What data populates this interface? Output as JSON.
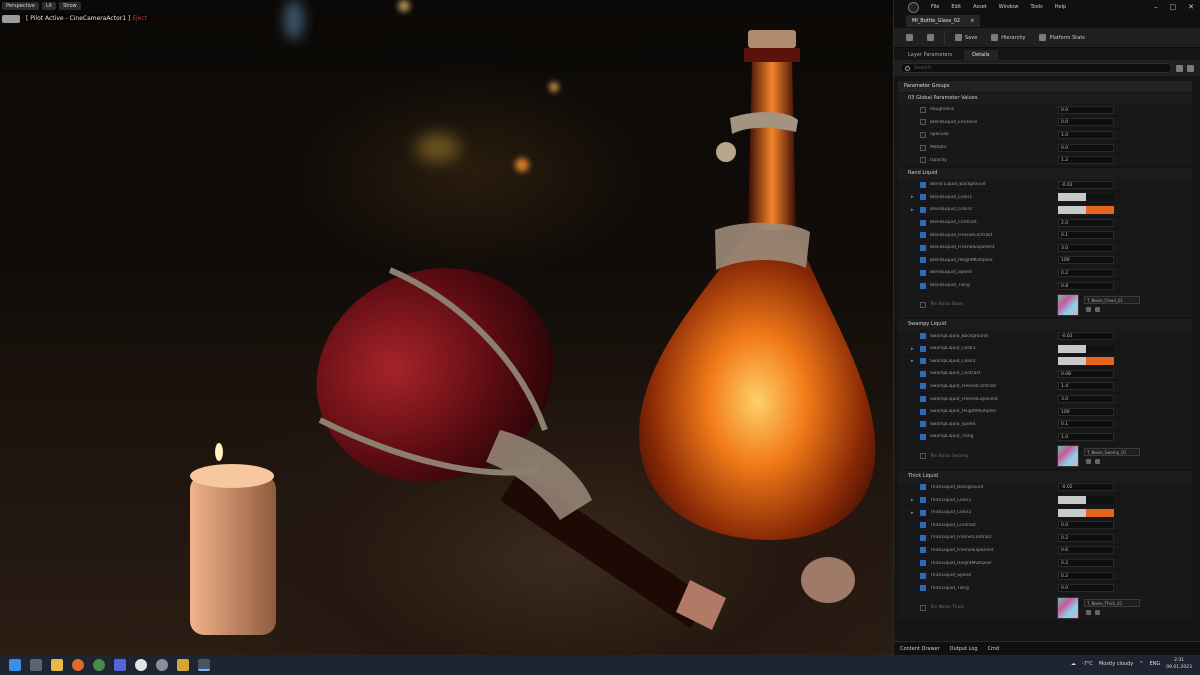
{
  "viewport": {
    "chips": [
      "Perspective",
      "Lit",
      "Show"
    ],
    "pilot_label": "[ Pilot Active - CineCameraActor1 ]",
    "pilot_exit": "Eject"
  },
  "editor": {
    "menu": [
      "File",
      "Edit",
      "Asset",
      "Window",
      "Tools",
      "Help"
    ],
    "tab": "MI_Bottle_Glass_02",
    "toolbar": [
      "Save",
      "Browse",
      "Hierarchy",
      "Platform Stats"
    ],
    "subtabs": [
      "Layer Parameters",
      "Details"
    ],
    "search_placeholder": "Search"
  },
  "props": {
    "category": "Parameter Groups",
    "groups": [
      {
        "title": "03 Global Parameter Values",
        "rows": [
          {
            "label": "Roughness",
            "value": "0.0",
            "on": false
          },
          {
            "label": "BlendLiquid_Emissive",
            "value": "0.0",
            "on": false
          },
          {
            "label": "Specular",
            "value": "1.0",
            "on": false
          },
          {
            "label": "Metallic",
            "value": "0.0",
            "on": false
          },
          {
            "label": "Opacity",
            "value": "1.2",
            "on": false
          }
        ]
      },
      {
        "title": "Rand Liquid",
        "rows": [
          {
            "label": "Blend Liquid_Background",
            "value": "-0.02",
            "on": true
          },
          {
            "label": "BlendLiquid_Color1",
            "swatch": [
              "#c9c9c9",
              "#111111"
            ],
            "on": true,
            "expand": true
          },
          {
            "label": "BlendLiquid_Color2",
            "swatch": [
              "#c9c9c9",
              "#e8661c"
            ],
            "on": true,
            "expand": true
          },
          {
            "label": "BlendLiquid_Contrast",
            "value": "2.0",
            "on": true
          },
          {
            "label": "BlendLiquid_FresnelContrast",
            "value": "0.1",
            "on": true
          },
          {
            "label": "BlendLiquid_FresnelExponent",
            "value": "3.0",
            "on": true
          },
          {
            "label": "BlendLiquid_HeightMultiplier",
            "value": "100",
            "on": true
          },
          {
            "label": "BlendLiquid_Speed",
            "value": "0.2",
            "on": true
          },
          {
            "label": "BlendLiquid_Tiling",
            "value": "0.8",
            "on": true
          }
        ],
        "texture": {
          "label": "Tex Noise Base",
          "dropdown": "T_Noise_Cloud_01"
        }
      },
      {
        "title": "Swampy Liquid",
        "rows": [
          {
            "label": "SwampLiquid_Background",
            "value": "-0.02",
            "on": true
          },
          {
            "label": "SwampLiquid_Color1",
            "swatch": [
              "#c9c9c9",
              "#111111"
            ],
            "on": true,
            "expand": true
          },
          {
            "label": "SwampLiquid_Color2",
            "swatch": [
              "#c9c9c9",
              "#e8661c"
            ],
            "on": true,
            "expand": true
          },
          {
            "label": "SwampLiquid_Contrast",
            "value": "0.08",
            "on": true
          },
          {
            "label": "SwampLiquid_FresnelContrast",
            "value": "1.4",
            "on": true
          },
          {
            "label": "SwampLiquid_FresnelExponent",
            "value": "3.0",
            "on": true
          },
          {
            "label": "SwampLiquid_HeightMultiplier",
            "value": "100",
            "on": true
          },
          {
            "label": "SwampLiquid_Speed",
            "value": "0.1",
            "on": true
          },
          {
            "label": "SwampLiquid_Tiling",
            "value": "1.0",
            "on": true
          }
        ],
        "texture": {
          "label": "Tex Noise Swamp",
          "dropdown": "T_Noise_Swamp_01"
        }
      },
      {
        "title": "Thick Liquid",
        "rows": [
          {
            "label": "ThickLiquid_Background",
            "value": "-0.02",
            "on": true
          },
          {
            "label": "ThickLiquid_Color1",
            "swatch": [
              "#c9c9c9",
              "#111111"
            ],
            "on": true,
            "expand": true
          },
          {
            "label": "ThickLiquid_Color2",
            "swatch": [
              "#c9c9c9",
              "#e8661c"
            ],
            "on": true,
            "expand": true
          },
          {
            "label": "ThickLiquid_Contrast",
            "value": "0.0",
            "on": true
          },
          {
            "label": "ThickLiquid_FresnelContrast",
            "value": "0.2",
            "on": true
          },
          {
            "label": "ThickLiquid_FresnelExponent",
            "value": "0.6",
            "on": true
          },
          {
            "label": "ThickLiquid_HeightMultiplier",
            "value": "0.2",
            "on": true
          },
          {
            "label": "ThickLiquid_Speed",
            "value": "0.2",
            "on": true
          },
          {
            "label": "ThickLiquid_Tiling",
            "value": "0.0",
            "on": true
          }
        ],
        "texture": {
          "label": "Tex Noise Thick",
          "dropdown": "T_Noise_Thick_01"
        }
      }
    ]
  },
  "bottom": {
    "items": [
      "Content Drawer",
      "Output Log",
      "Cmd"
    ]
  },
  "taskbar": {
    "weather": "-7°C",
    "weather_desc": "Mostly cloudy",
    "lang": "ENG",
    "time": "2:31",
    "date": "09.01.2023"
  }
}
